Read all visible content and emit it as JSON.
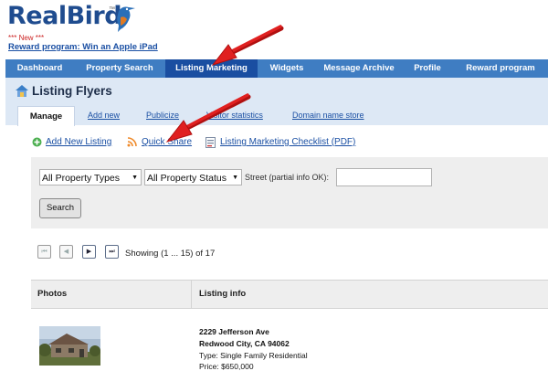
{
  "app": {
    "logo_text_1": "Real",
    "logo_text_2": "Bird",
    "logo_tm": "™",
    "new_tag": "*** New ***",
    "reward_link": "Reward program: Win an Apple iPad"
  },
  "nav": {
    "items": [
      {
        "label": "Dashboard"
      },
      {
        "label": "Property Search"
      },
      {
        "label": "Listing Marketing"
      },
      {
        "label": "Widgets"
      },
      {
        "label": "Message Archive"
      },
      {
        "label": "Profile"
      },
      {
        "label": "Reward program"
      }
    ],
    "active_index": 2
  },
  "page": {
    "title": "Listing Flyers",
    "tabs": [
      {
        "label": "Manage"
      },
      {
        "label": "Add new"
      },
      {
        "label": "Publicize"
      },
      {
        "label": "Visitor statistics"
      },
      {
        "label": "Domain name store"
      }
    ]
  },
  "actions": {
    "add_new_listing": "Add New Listing",
    "quick_share": "Quick Share",
    "checklist": "Listing Marketing Checklist (PDF)"
  },
  "filters": {
    "property_type": "All Property Types",
    "property_status": "All Property Status",
    "street_label": "Street (partial info OK):",
    "street_value": "",
    "search_label": "Search"
  },
  "pager": {
    "first": "⏮",
    "prev": "◀",
    "next": "▶",
    "last": "⏭",
    "status": "Showing (1 ... 15) of 17"
  },
  "table": {
    "headers": [
      "Photos",
      "Listing info"
    ],
    "rows": [
      {
        "street": "2229 Jefferson Ave",
        "city": "Redwood City, CA 94062",
        "type": "Type: Single Family Residential",
        "price": "Price: $650,000"
      }
    ]
  },
  "colors": {
    "nav_bg": "#3f7dc2",
    "nav_active": "#1a4ea1",
    "link": "#1a4fa3",
    "arrow": "#e02020"
  }
}
